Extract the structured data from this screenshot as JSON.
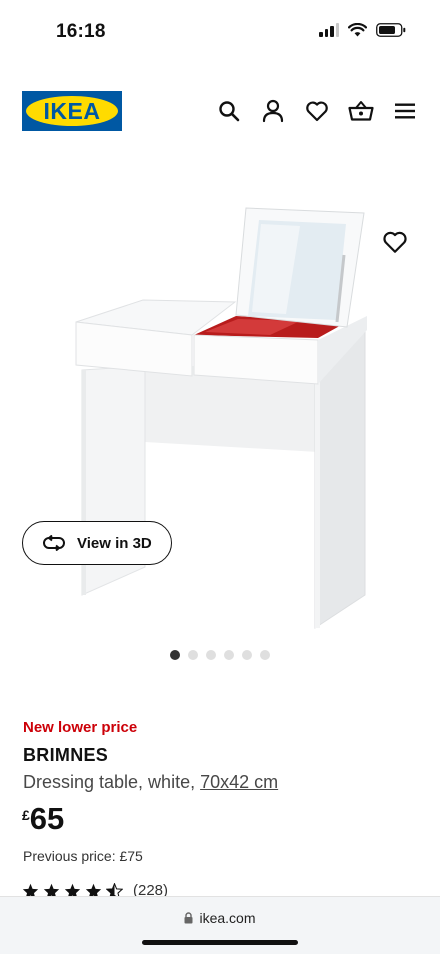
{
  "status": {
    "time": "16:18"
  },
  "header": {
    "logo_text": "IKEA",
    "brand_blue": "#0058a3",
    "brand_yellow": "#ffdb00",
    "icons": [
      "search-icon",
      "account-icon",
      "heart-icon",
      "basket-icon",
      "menu-icon"
    ]
  },
  "gallery": {
    "view_3d_label": "View in 3D",
    "image_count": 6,
    "active_index": 0
  },
  "product": {
    "badge": "New lower price",
    "badge_color": "#cc0008",
    "name": "BRIMNES",
    "description": "Dressing table, white, ",
    "dimensions": "70x42 cm",
    "currency": "£",
    "price": "65",
    "previous_price": "Previous price: £75",
    "rating": 4.5,
    "rating_count": "(228)"
  },
  "browser": {
    "url": "ikea.com"
  }
}
